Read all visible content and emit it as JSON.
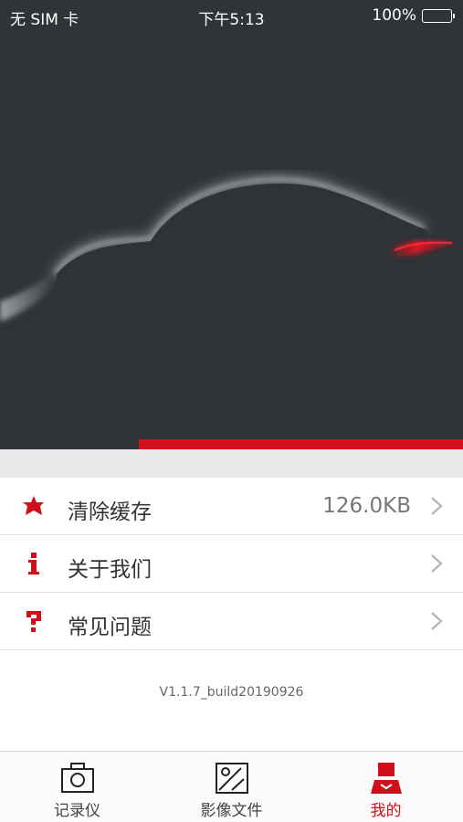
{
  "status_bar": {
    "carrier": "无 SIM 卡",
    "time": "下午5:13",
    "battery": "100%"
  },
  "menu": {
    "items": [
      {
        "label": "清除缓存",
        "value": "126.0KB",
        "icon": "star-icon"
      },
      {
        "label": "关于我们",
        "value": "",
        "icon": "info-icon"
      },
      {
        "label": "常见问题",
        "value": "",
        "icon": "question-icon"
      }
    ]
  },
  "version": "V1.1.7_build20190926",
  "tabbar": {
    "tabs": [
      {
        "label": "记录仪",
        "icon": "camera-icon",
        "active": false
      },
      {
        "label": "影像文件",
        "icon": "image-icon",
        "active": false
      },
      {
        "label": "我的",
        "icon": "profile-icon",
        "active": true
      }
    ]
  },
  "colors": {
    "accent": "#d3101c",
    "hero_bg": "#303437",
    "band_bg": "#eaeaec"
  }
}
